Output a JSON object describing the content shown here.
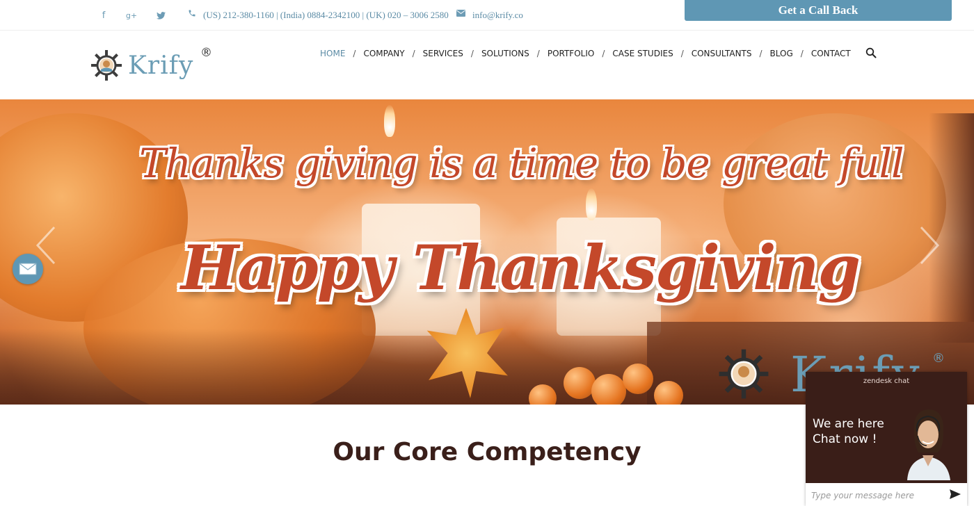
{
  "topbar": {
    "social": [
      {
        "name": "facebook",
        "glyph": "f"
      },
      {
        "name": "google-plus",
        "glyph": "g+"
      },
      {
        "name": "twitter",
        "glyph": "t"
      }
    ],
    "phone": "(US) 212-380-1160 | (India) 0884-2342100 | (UK) 020 – 3006 2580",
    "email": "info@krify.co",
    "callback_label": "Get a Call Back"
  },
  "header": {
    "logo_text": "Krify",
    "logo_reg": "®",
    "nav": [
      {
        "label": "HOME",
        "active": true
      },
      {
        "label": "COMPANY"
      },
      {
        "label": "SERVICES"
      },
      {
        "label": "SOLUTIONS"
      },
      {
        "label": "PORTFOLIO"
      },
      {
        "label": "CASE STUDIES"
      },
      {
        "label": "CONSULTANTS"
      },
      {
        "label": "BLOG"
      },
      {
        "label": "CONTACT"
      }
    ],
    "nav_separator": "/"
  },
  "hero": {
    "headline": "Thanks giving is a time to be great full",
    "subline": "Happy Thanksgiving",
    "logo_text": "Krify",
    "logo_reg": "®"
  },
  "section": {
    "title": "Our Core Competency"
  },
  "chat": {
    "brand": "zendesk chat",
    "message_line1": "We are here",
    "message_line2": "Chat now !",
    "input_placeholder": "Type your message here"
  },
  "colors": {
    "accent": "#5f97b4",
    "brand_blue": "#6b9db5",
    "hero_text": "#c4482a",
    "chat_bg": "#3a1e18"
  }
}
